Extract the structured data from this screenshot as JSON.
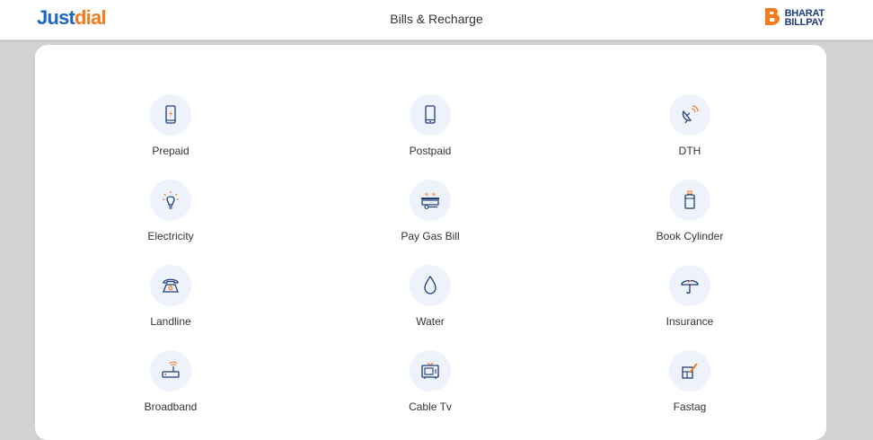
{
  "header": {
    "logo_part1": "Just",
    "logo_part2": "dial",
    "title": "Bills & Recharge",
    "partner_logo_line1": "BHARAT",
    "partner_logo_line2": "BILLPAY"
  },
  "services": [
    {
      "label": "Prepaid",
      "icon": "mobile-recharge-icon"
    },
    {
      "label": "Postpaid",
      "icon": "mobile-icon"
    },
    {
      "label": "DTH",
      "icon": "satellite-dish-icon"
    },
    {
      "label": "Electricity",
      "icon": "bulb-icon"
    },
    {
      "label": "Pay Gas Bill",
      "icon": "gas-stove-icon"
    },
    {
      "label": "Book Cylinder",
      "icon": "gas-cylinder-icon"
    },
    {
      "label": "Landline",
      "icon": "telephone-icon"
    },
    {
      "label": "Water",
      "icon": "water-drop-icon"
    },
    {
      "label": "Insurance",
      "icon": "umbrella-icon"
    },
    {
      "label": "Broadband",
      "icon": "router-icon"
    },
    {
      "label": "Cable Tv",
      "icon": "tv-icon"
    },
    {
      "label": "Fastag",
      "icon": "fastag-icon"
    }
  ],
  "colors": {
    "brand_blue": "#1d66c1",
    "brand_orange": "#f57b20",
    "icon_stroke": "#1f3d7a",
    "icon_accent": "#f57b20",
    "icon_circle": "#eef3fb"
  }
}
